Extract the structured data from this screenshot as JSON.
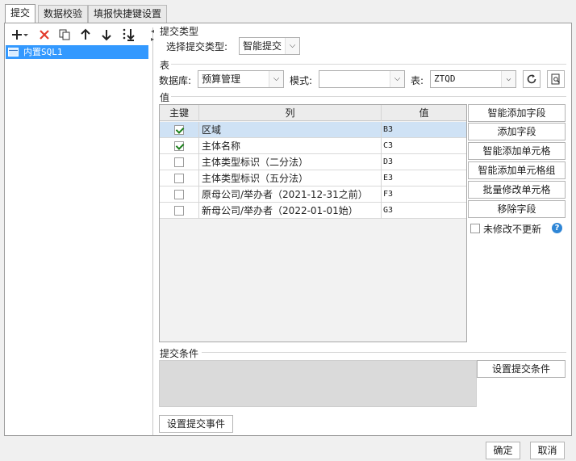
{
  "tabs": [
    {
      "label": "提交",
      "active": true
    },
    {
      "label": "数据校验",
      "active": false
    },
    {
      "label": "填报快捷键设置",
      "active": false
    }
  ],
  "toolbar": {
    "icons": [
      "add-icon",
      "dropdown-arrow-icon",
      "delete-icon",
      "copy-icon",
      "move-up-icon",
      "move-down-icon",
      "sort-bottom-icon"
    ]
  },
  "tree": {
    "items": [
      {
        "label": "内置SQL1",
        "selected": true
      }
    ]
  },
  "submit_type": {
    "section_label": "提交类型",
    "field_label": "选择提交类型:",
    "value": "智能提交"
  },
  "table_section": {
    "section_label": "表",
    "database_label": "数据库:",
    "database_value": "预算管理",
    "schema_label": "模式:",
    "schema_value": "",
    "table_label": "表:",
    "table_value": "ZTQD"
  },
  "values_section": {
    "section_label": "值",
    "columns": [
      "主键",
      "列",
      "值"
    ],
    "rows": [
      {
        "key": true,
        "column": "区域",
        "value": "B3",
        "selected": true
      },
      {
        "key": true,
        "column": "主体名称",
        "value": "C3",
        "selected": false
      },
      {
        "key": false,
        "column": "主体类型标识（二分法）",
        "value": "D3",
        "selected": false
      },
      {
        "key": false,
        "column": "主体类型标识（五分法）",
        "value": "E3",
        "selected": false
      },
      {
        "key": false,
        "column": "原母公司/举办者（2021-12-31之前）",
        "value": "F3",
        "selected": false
      },
      {
        "key": false,
        "column": "新母公司/举办者（2022-01-01始）",
        "value": "G3",
        "selected": false
      }
    ]
  },
  "side_buttons": {
    "smart_add_field": "智能添加字段",
    "add_field": "添加字段",
    "smart_add_cell": "智能添加单元格",
    "smart_add_cell_group": "智能添加单元格组",
    "batch_modify_cell": "批量修改单元格",
    "remove_field": "移除字段",
    "no_update_unmodified": "未修改不更新",
    "no_update_checked": false
  },
  "submit_condition": {
    "section_label": "提交条件",
    "button": "设置提交条件"
  },
  "submit_event": {
    "button": "设置提交事件"
  },
  "footer": {
    "ok": "确定",
    "cancel": "取消"
  },
  "colors": {
    "selection": "#3399ff",
    "row_selected": "#cfe2f5",
    "help": "#2f86d6",
    "delete": "#e23a2c"
  }
}
